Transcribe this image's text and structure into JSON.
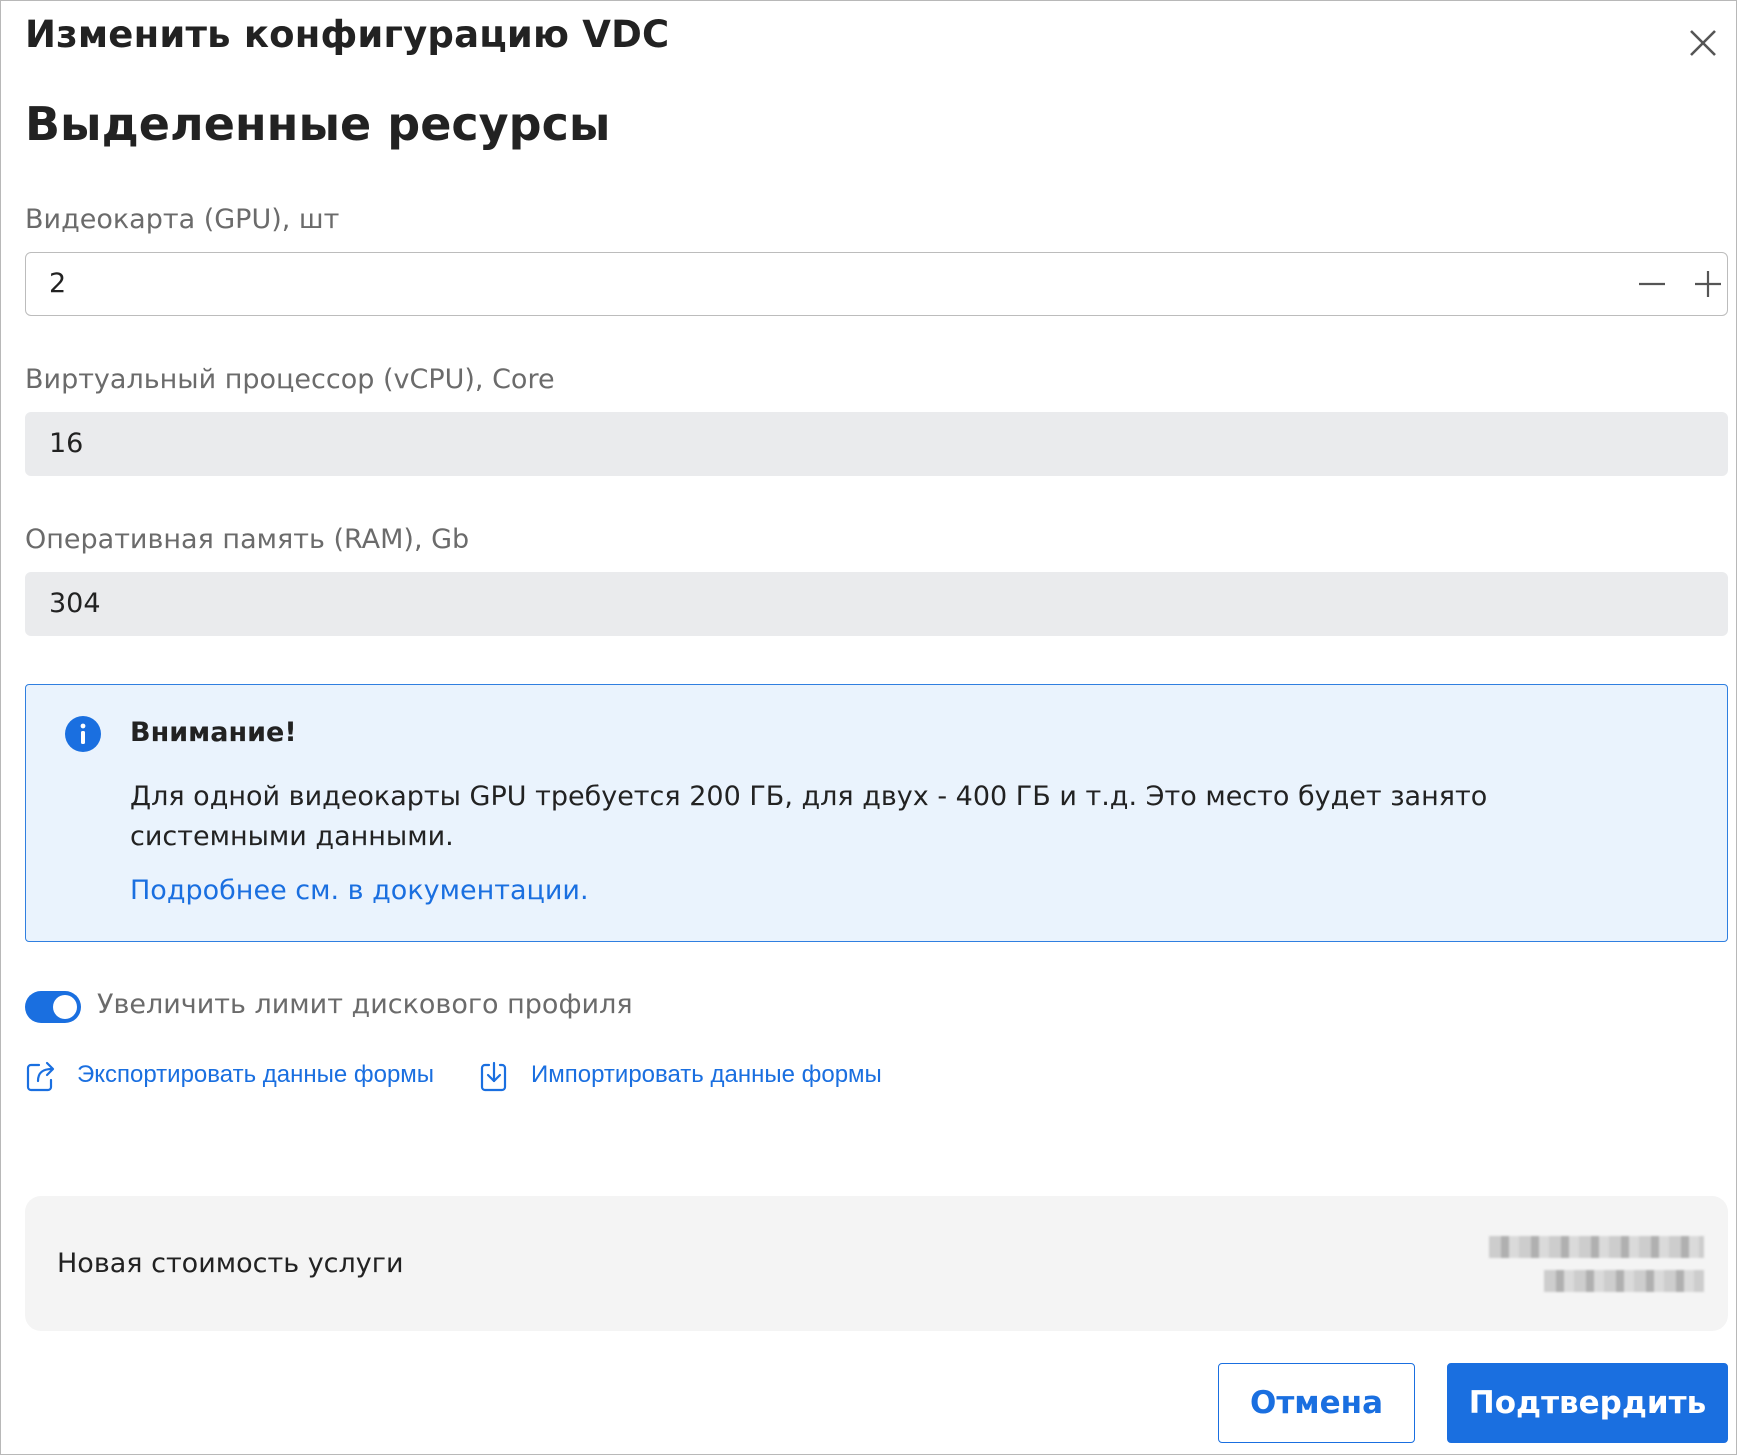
{
  "modal": {
    "title": "Изменить конфигурацию VDC",
    "close_icon": "close-icon"
  },
  "section": {
    "title": "Выделенные ресурсы"
  },
  "fields": {
    "gpu": {
      "label": "Видеокарта (GPU), шт",
      "value": "2"
    },
    "vcpu": {
      "label": "Виртуальный процессор (vCPU), Core",
      "value": "16"
    },
    "ram": {
      "label": "Оперативная память (RAM), Gb",
      "value": "304"
    }
  },
  "alert": {
    "icon": "info-icon",
    "title": "Внимание!",
    "text": "Для одной видеокарты GPU требуется 200 ГБ, для двух - 400 ГБ и т.д. Это место будет занято системными данными.",
    "link": "Подробнее см. в документации."
  },
  "toggle": {
    "label": "Увеличить лимит дискового профиля",
    "on": true
  },
  "links": {
    "export_label": "Экспортировать данные формы",
    "import_label": "Импортировать данные формы"
  },
  "price": {
    "label": "Новая стоимость услуги"
  },
  "buttons": {
    "cancel": "Отмена",
    "confirm": "Подтвердить"
  },
  "colors": {
    "accent": "#1a6fe0",
    "alert_bg": "#eaf3fd",
    "readonly_bg": "#eaebed"
  }
}
